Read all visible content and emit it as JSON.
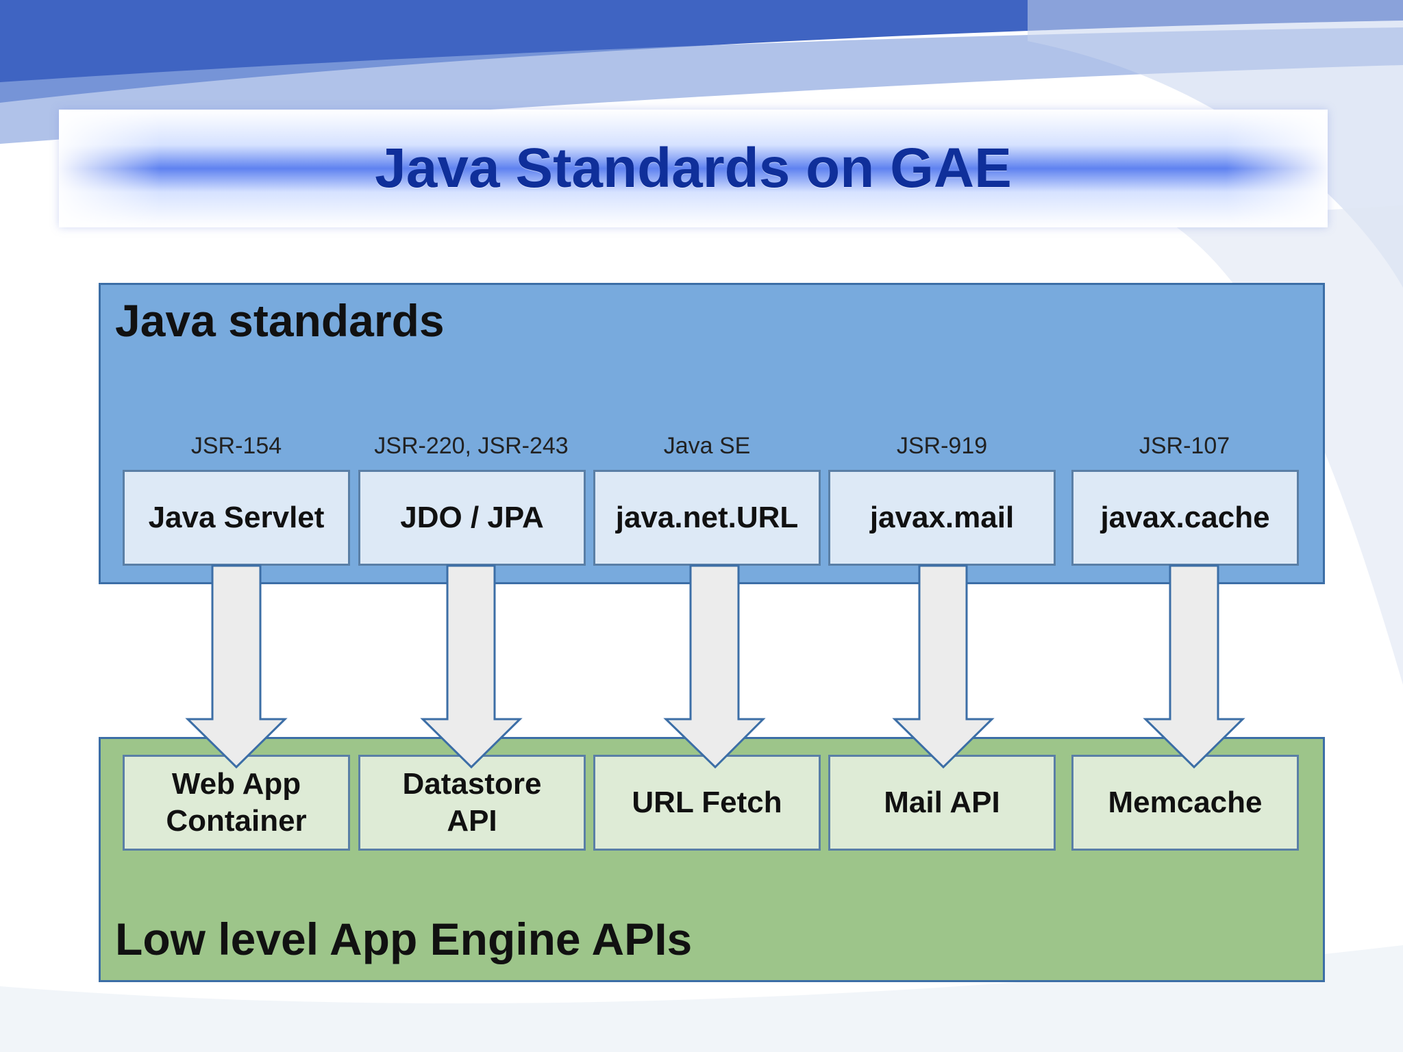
{
  "slide": {
    "title": "Java Standards on GAE"
  },
  "diagram": {
    "top_panel_label": "Java standards",
    "bottom_panel_label": "Low level App Engine APIs",
    "columns": [
      {
        "spec": "JSR-154",
        "standard": "Java Servlet",
        "api": "Web App\nContainer"
      },
      {
        "spec": "JSR-220, JSR-243",
        "standard": "JDO / JPA",
        "api": "Datastore\nAPI"
      },
      {
        "spec": "Java SE",
        "standard": "java.net.URL",
        "api": "URL Fetch"
      },
      {
        "spec": "JSR-919",
        "standard": "javax.mail",
        "api": "Mail API"
      },
      {
        "spec": "JSR-107",
        "standard": "javax.cache",
        "api": "Memcache"
      }
    ]
  },
  "colors": {
    "title": "#0f2f9a",
    "top_panel": "#78aadd",
    "bottom_panel": "#9dc58a",
    "standard_box": "#dde9f6",
    "api_box": "#deebd6",
    "arrow_fill": "#ececec",
    "border": "#3c6ea6"
  }
}
